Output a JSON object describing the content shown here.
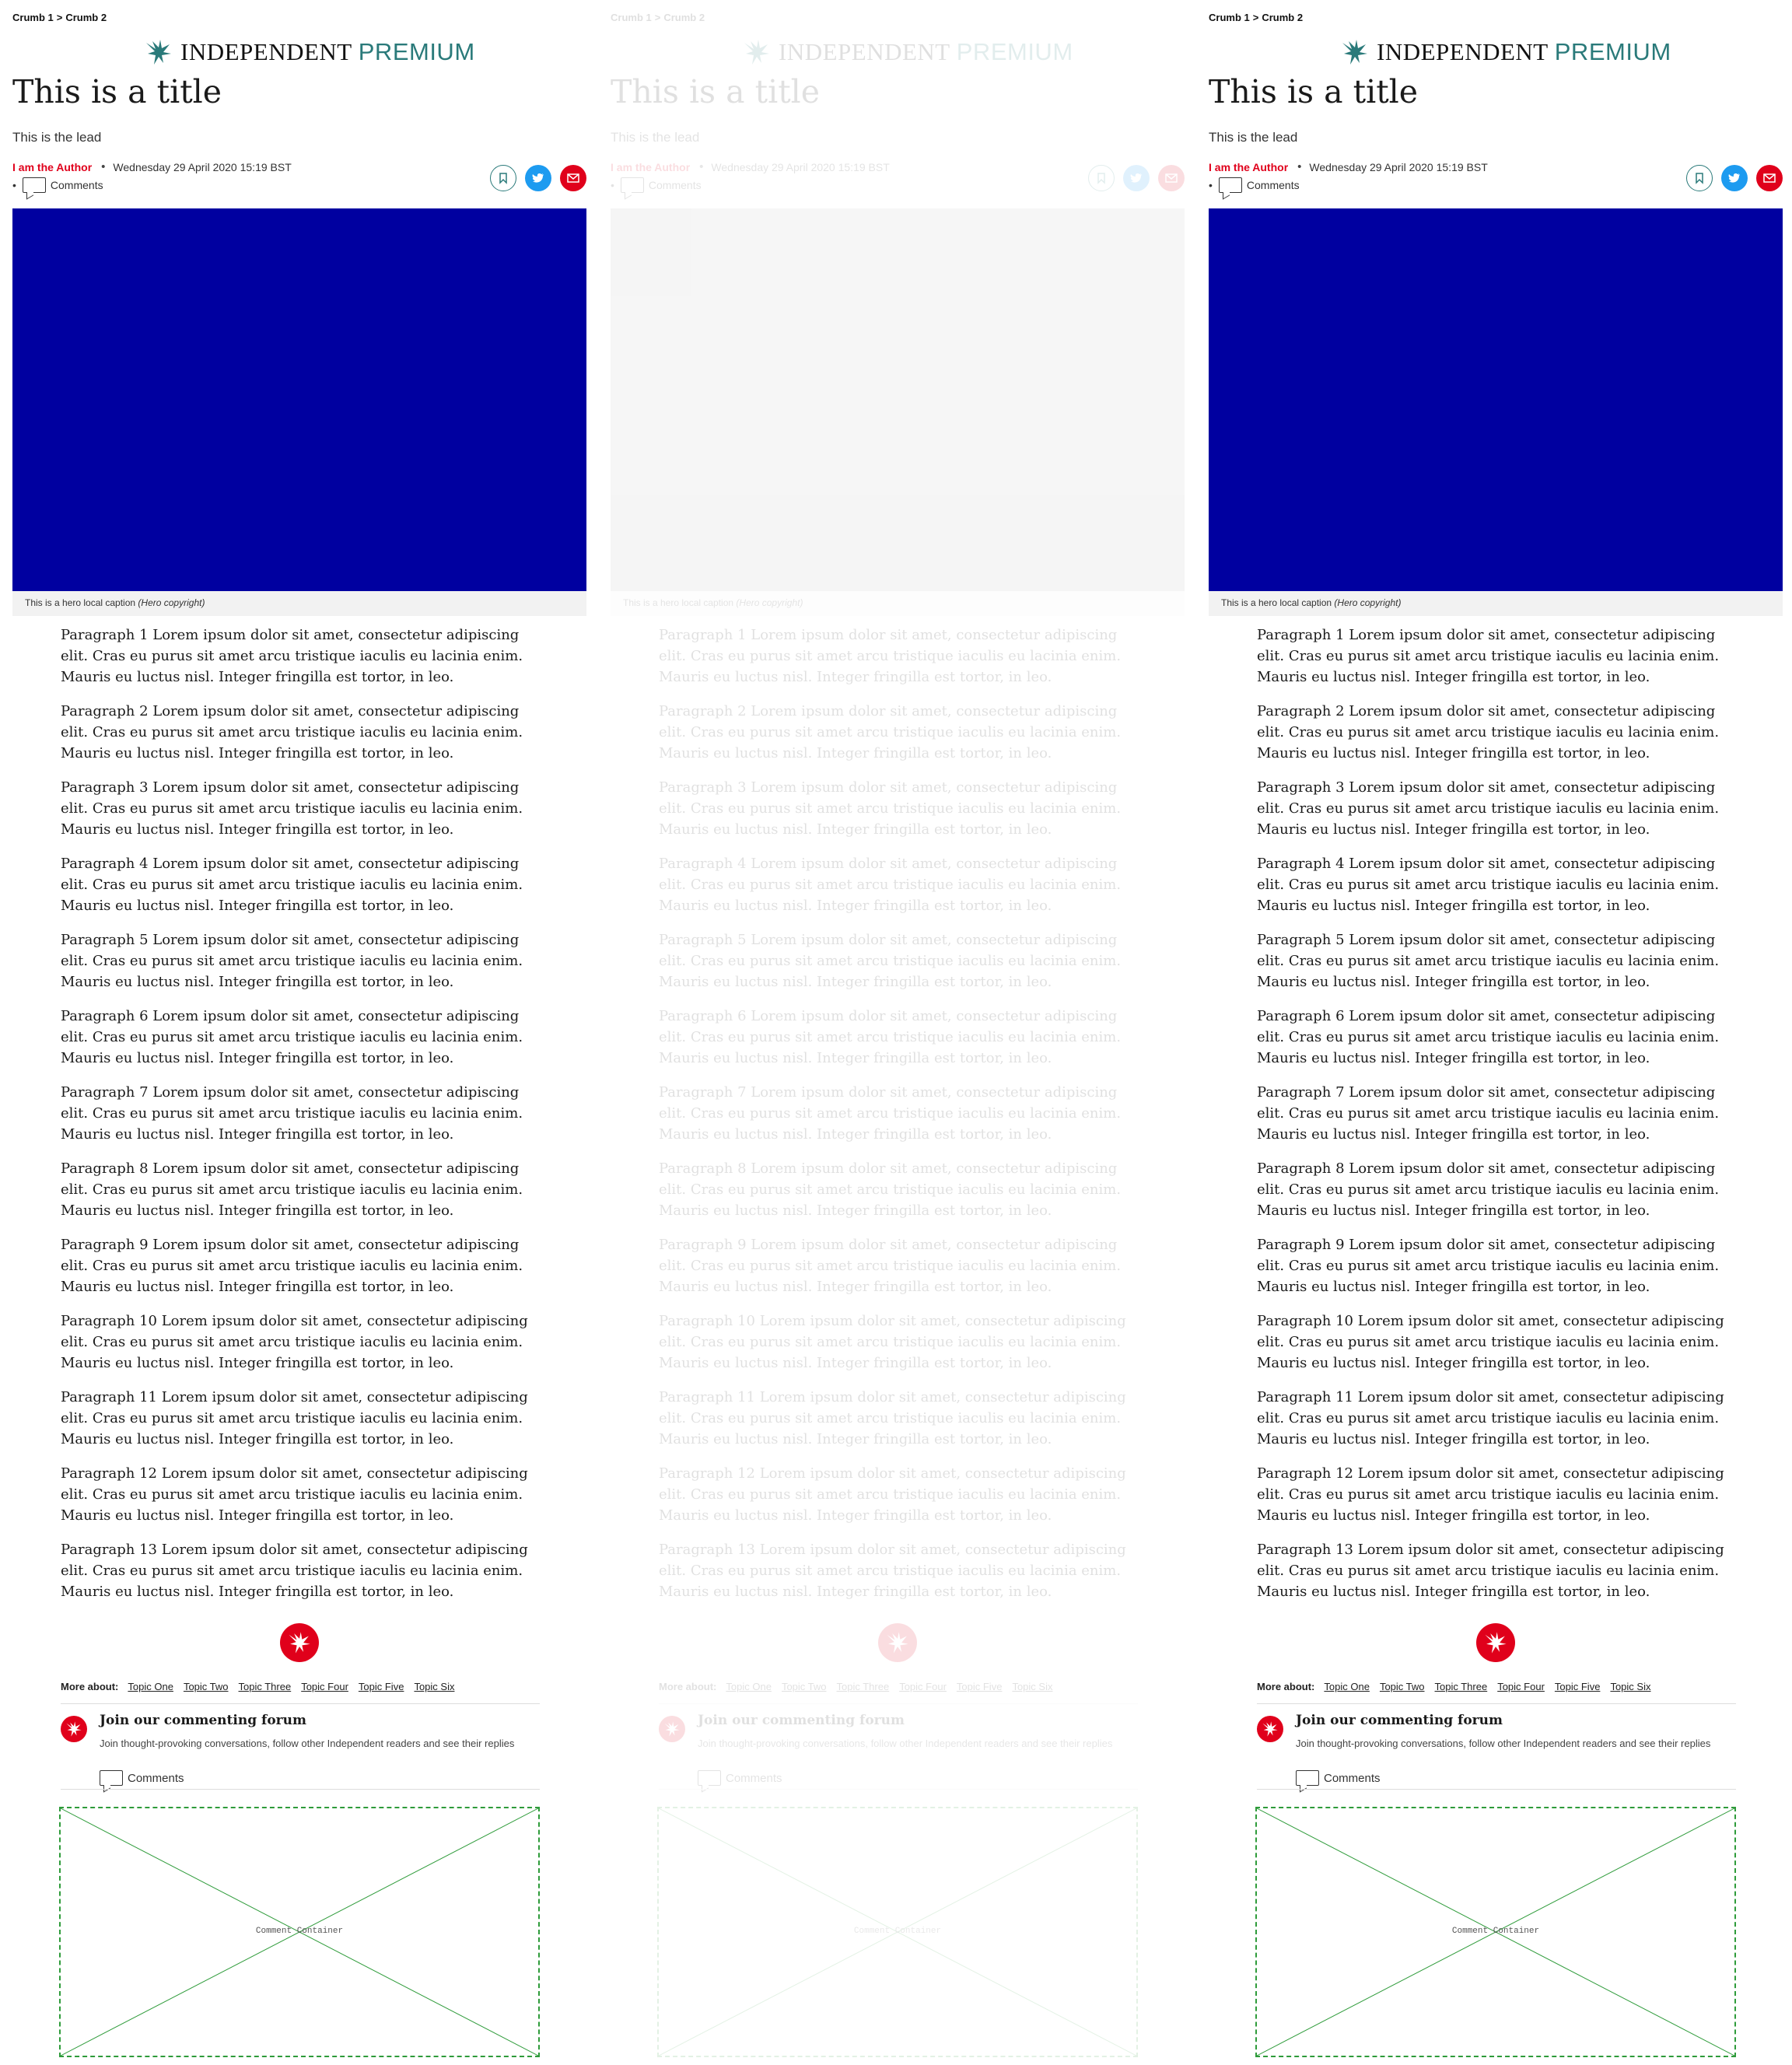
{
  "breadcrumbs": [
    "Crumb 1",
    "Crumb 2"
  ],
  "breadcrumb_separator": ">",
  "logo": {
    "main": "INDEPENDENT",
    "suffix": "PREMIUM"
  },
  "article": {
    "title": "This is a title",
    "lead": "This is the lead",
    "author": "I am the Author",
    "bullet": "•",
    "date": "Wednesday 29 April 2020 15:19 BST",
    "comments_label": "Comments",
    "hero_caption": "This is a hero local caption",
    "hero_copyright": "(Hero copyright)",
    "paragraphs": [
      "Paragraph 1 Lorem ipsum dolor sit amet, consectetur adipiscing elit. Cras eu purus sit amet arcu tristique iaculis eu lacinia enim. Mauris eu luctus nisl. Integer fringilla est tortor, in leo.",
      "Paragraph 2 Lorem ipsum dolor sit amet, consectetur adipiscing elit. Cras eu purus sit amet arcu tristique iaculis eu lacinia enim. Mauris eu luctus nisl. Integer fringilla est tortor, in leo.",
      "Paragraph 3 Lorem ipsum dolor sit amet, consectetur adipiscing elit. Cras eu purus sit amet arcu tristique iaculis eu lacinia enim. Mauris eu luctus nisl. Integer fringilla est tortor, in leo.",
      "Paragraph 4 Lorem ipsum dolor sit amet, consectetur adipiscing elit. Cras eu purus sit amet arcu tristique iaculis eu lacinia enim. Mauris eu luctus nisl. Integer fringilla est tortor, in leo.",
      "Paragraph 5 Lorem ipsum dolor sit amet, consectetur adipiscing elit. Cras eu purus sit amet arcu tristique iaculis eu lacinia enim. Mauris eu luctus nisl. Integer fringilla est tortor, in leo.",
      "Paragraph 6 Lorem ipsum dolor sit amet, consectetur adipiscing elit. Cras eu purus sit amet arcu tristique iaculis eu lacinia enim. Mauris eu luctus nisl. Integer fringilla est tortor, in leo.",
      "Paragraph 7 Lorem ipsum dolor sit amet, consectetur adipiscing elit. Cras eu purus sit amet arcu tristique iaculis eu lacinia enim. Mauris eu luctus nisl. Integer fringilla est tortor, in leo.",
      "Paragraph 8 Lorem ipsum dolor sit amet, consectetur adipiscing elit. Cras eu purus sit amet arcu tristique iaculis eu lacinia enim. Mauris eu luctus nisl. Integer fringilla est tortor, in leo.",
      "Paragraph 9 Lorem ipsum dolor sit amet, consectetur adipiscing elit. Cras eu purus sit amet arcu tristique iaculis eu lacinia enim. Mauris eu luctus nisl. Integer fringilla est tortor, in leo.",
      "Paragraph 10 Lorem ipsum dolor sit amet, consectetur adipiscing elit. Cras eu purus sit amet arcu tristique iaculis eu lacinia enim. Mauris eu luctus nisl. Integer fringilla est tortor, in leo.",
      "Paragraph 11 Lorem ipsum dolor sit amet, consectetur adipiscing elit. Cras eu purus sit amet arcu tristique iaculis eu lacinia enim. Mauris eu luctus nisl. Integer fringilla est tortor, in leo.",
      "Paragraph 12 Lorem ipsum dolor sit amet, consectetur adipiscing elit. Cras eu purus sit amet arcu tristique iaculis eu lacinia enim. Mauris eu luctus nisl. Integer fringilla est tortor, in leo.",
      "Paragraph 13 Lorem ipsum dolor sit amet, consectetur adipiscing elit. Cras eu purus sit amet arcu tristique iaculis eu lacinia enim. Mauris eu luctus nisl. Integer fringilla est tortor, in leo."
    ]
  },
  "more_about": {
    "label": "More about:",
    "topics": [
      "Topic One",
      "Topic Two",
      "Topic Three",
      "Topic Four",
      "Topic Five",
      "Topic Six"
    ]
  },
  "forum": {
    "heading": "Join our commenting forum",
    "description": "Join thought-provoking conversations, follow other Independent readers and see their replies",
    "comments_label": "Comments"
  },
  "comment_container_label": "Comment Container",
  "icons": {
    "logo": "eagle-icon",
    "share": [
      "bookmark-icon",
      "twitter-icon",
      "email-icon"
    ],
    "comments": "comment-bubble-icon",
    "footer_badge": "eagle-icon"
  },
  "colors": {
    "brand_red": "#e0001b",
    "premium_teal": "#2a7a7a",
    "hero_blue": "#0000a0",
    "twitter_blue": "#1d9bf0",
    "placeholder_green": "#2e9b3a"
  }
}
